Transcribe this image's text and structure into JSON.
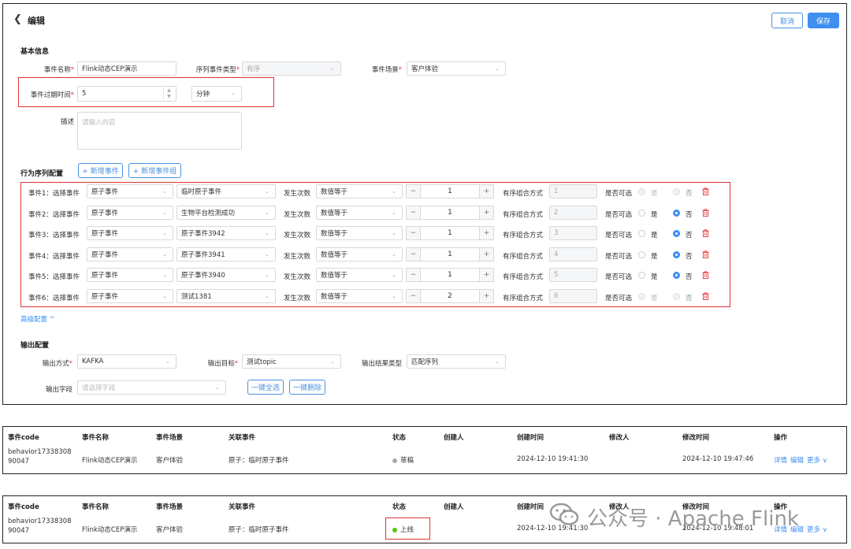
{
  "header": {
    "back_icon": "chevron-left-icon",
    "title": "编辑",
    "cancel_label": "取消",
    "save_label": "保存"
  },
  "basic": {
    "section_title": "基本信息",
    "event_name_label": "事件名称",
    "event_name_value": "Flink动态CEP演示",
    "seq_type_label": "序列事件类型",
    "seq_type_value": "有序",
    "scene_label": "事件场景",
    "scene_value": "客户体验",
    "expire_label": "事件过期时间",
    "expire_value": "5",
    "expire_unit": "分钟",
    "desc_label": "描述",
    "desc_placeholder": "请输入内容"
  },
  "behavior": {
    "section_title": "行为序列配置",
    "add_event_label": "+ 新增事件",
    "add_group_label": "+ 新增事件组",
    "col_count_label": "发生次数",
    "col_combo_label": "有序组合方式",
    "col_optional_label": "是否可选",
    "yes_label": "是",
    "no_label": "否",
    "rows": [
      {
        "label": "事件1：选择事件",
        "type": "原子事件",
        "event": "临时原子事件",
        "op": "数值等于",
        "count": "1",
        "combo": "1",
        "no_checked": false,
        "disabled": true
      },
      {
        "label": "事件2：选择事件",
        "type": "原子事件",
        "event": "生物平台检测成功",
        "op": "数值等于",
        "count": "1",
        "combo": "2",
        "no_checked": true,
        "disabled": false
      },
      {
        "label": "事件3：选择事件",
        "type": "原子事件",
        "event": "原子事件3942",
        "op": "数值等于",
        "count": "1",
        "combo": "3",
        "no_checked": true,
        "disabled": false
      },
      {
        "label": "事件4：选择事件",
        "type": "原子事件",
        "event": "原子事件3941",
        "op": "数值等于",
        "count": "1",
        "combo": "4",
        "no_checked": true,
        "disabled": false
      },
      {
        "label": "事件5：选择事件",
        "type": "原子事件",
        "event": "原子事件3940",
        "op": "数值等于",
        "count": "1",
        "combo": "5",
        "no_checked": true,
        "disabled": false
      },
      {
        "label": "事件6：选择事件",
        "type": "原子事件",
        "event": "测试1381",
        "op": "数值等于",
        "count": "2",
        "combo": "6",
        "no_checked": false,
        "disabled": true
      }
    ],
    "advanced_label": "高级配置 ^"
  },
  "output": {
    "section_title": "输出配置",
    "mode_label": "输出方式",
    "mode_value": "KAFKA",
    "target_label": "输出目标",
    "target_value": "测试topic",
    "result_type_label": "输出结果类型",
    "result_type_value": "匹配序列",
    "field_label": "输出字段",
    "field_placeholder": "请选择字段",
    "select_all_label": "一键全选",
    "delete_all_label": "一键删除"
  },
  "table": {
    "headers": [
      "事件code",
      "事件名称",
      "事件场景",
      "关联事件",
      "状态",
      "创建人",
      "创建时间",
      "修改人",
      "修改时间",
      "操作"
    ],
    "row1": {
      "code_line1": "behavior17338308",
      "code_line2": "90047",
      "name": "Flink动态CEP演示",
      "scene": "客户体验",
      "related": "原子：临时原子事件",
      "status": "草稿",
      "status_color": "#aaaaaa",
      "creator": "",
      "created": "2024-12-10 19:41:30",
      "modifier": "",
      "modified": "2024-12-10 19:47:46",
      "op_detail": "详情",
      "op_edit": "编辑",
      "op_more": "更多 ∨"
    },
    "row2": {
      "code_line1": "behavior17338308",
      "code_line2": "90047",
      "name": "Flink动态CEP演示",
      "scene": "客户体验",
      "related": "原子：临时原子事件",
      "status": "上线",
      "status_color": "#52c41a",
      "creator": "",
      "created": "2024-12-10 19:41:30",
      "modifier": "",
      "modified": "2024-12-10 19:48:01",
      "op_detail": "详情",
      "op_edit": "编辑",
      "op_more": "更多 ∨"
    }
  },
  "watermark": {
    "text": "公众号 · Apache Flink",
    "icon": "wechat-icon"
  }
}
